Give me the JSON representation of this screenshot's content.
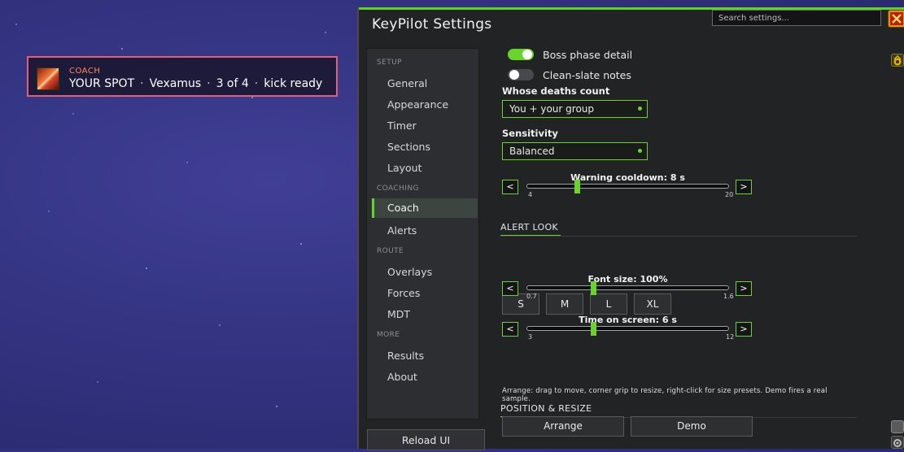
{
  "notice": {
    "caption": "COACH",
    "line": [
      "YOUR SPOT",
      "Vexamus",
      "3 of 4",
      "kick ready"
    ],
    "separator": "·",
    "icon": "coach-spell-icon"
  },
  "window": {
    "title": "KeyPilot Settings",
    "search_placeholder": "Search settings...",
    "close_icon": "close-icon",
    "accent_color": "#6ad42f"
  },
  "nav": {
    "groups": [
      {
        "label": "SETUP",
        "items": [
          "General",
          "Appearance",
          "Timer",
          "Sections",
          "Layout"
        ]
      },
      {
        "label": "COACHING",
        "items": [
          "Coach",
          "Alerts"
        ]
      },
      {
        "label": "ROUTE",
        "items": [
          "Overlays",
          "Forces",
          "MDT"
        ]
      },
      {
        "label": "MORE",
        "items": [
          "Results",
          "About"
        ]
      }
    ],
    "active": "Coach",
    "reload_label": "Reload UI"
  },
  "coach": {
    "toggles": [
      {
        "label": "Boss phase detail",
        "on": true
      },
      {
        "label": "Clean-slate notes",
        "on": false
      }
    ],
    "deaths_label": "Whose deaths count",
    "deaths_value": "You + your group",
    "sensitivity_label": "Sensitivity",
    "sensitivity_value": "Balanced",
    "warning_slider": {
      "title": "Warning cooldown:  8 s",
      "min": "4",
      "max": "20",
      "value_fraction": 0.25
    },
    "alert_look": {
      "title": "ALERT LOOK",
      "sizes": [
        "S",
        "M",
        "L",
        "XL"
      ],
      "font_slider": {
        "title": "Font size:  100%",
        "min": "0.7",
        "max": "1.6",
        "value_fraction": 0.33
      },
      "time_slider": {
        "title": "Time on screen:  6 s",
        "min": "3",
        "max": "12",
        "value_fraction": 0.33
      }
    },
    "position": {
      "title": "POSITION & RESIZE",
      "help": "Arrange: drag to move, corner grip to resize, right-click for size presets. Demo fires a real sample.",
      "arrange_label": "Arrange",
      "demo_label": "Demo"
    }
  },
  "side_icons": [
    "keystone-icon",
    "scroll-icon",
    "gear-icon"
  ]
}
